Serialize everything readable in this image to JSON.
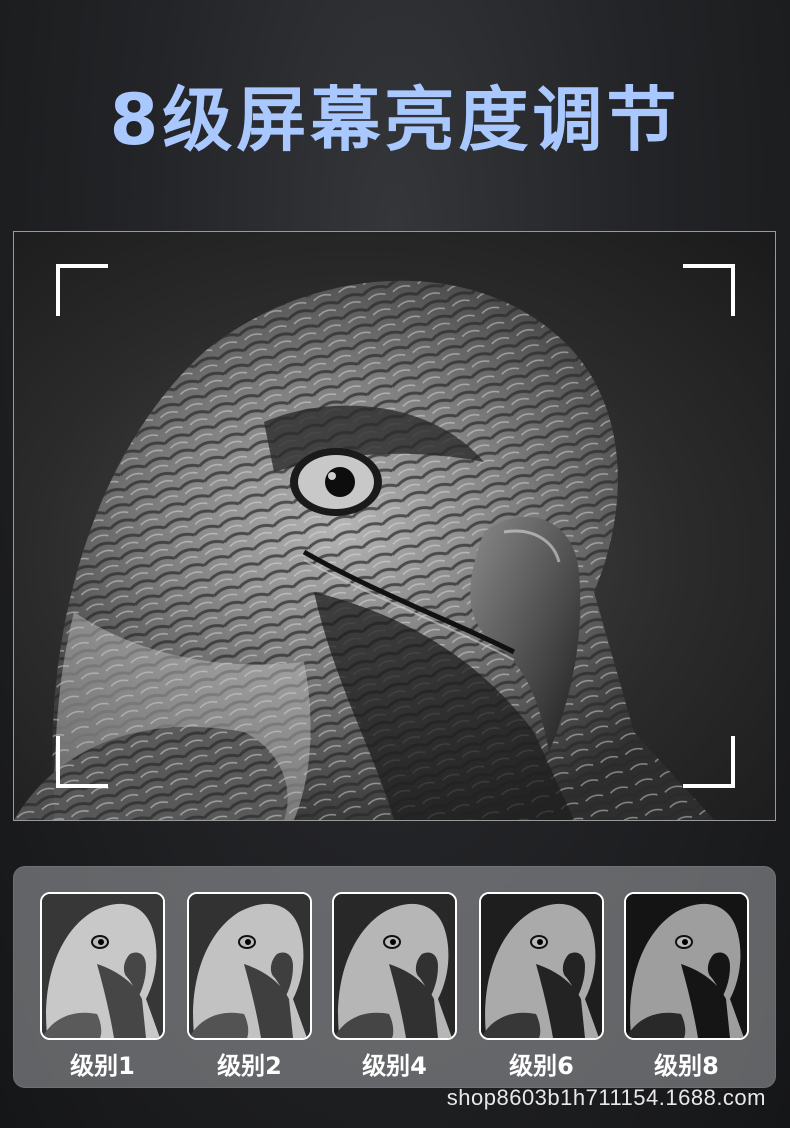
{
  "title": "8级屏幕亮度调节",
  "title_color": "#a9c8ff",
  "main_photo": {
    "subject": "hawk-head-grayscale"
  },
  "levels": [
    {
      "label": "级别1",
      "brightness": 1
    },
    {
      "label": "级别2",
      "brightness": 2
    },
    {
      "label": "级别4",
      "brightness": 4
    },
    {
      "label": "级别6",
      "brightness": 6
    },
    {
      "label": "级别8",
      "brightness": 8
    }
  ],
  "watermark": "shop8603b1h711154.1688.com"
}
